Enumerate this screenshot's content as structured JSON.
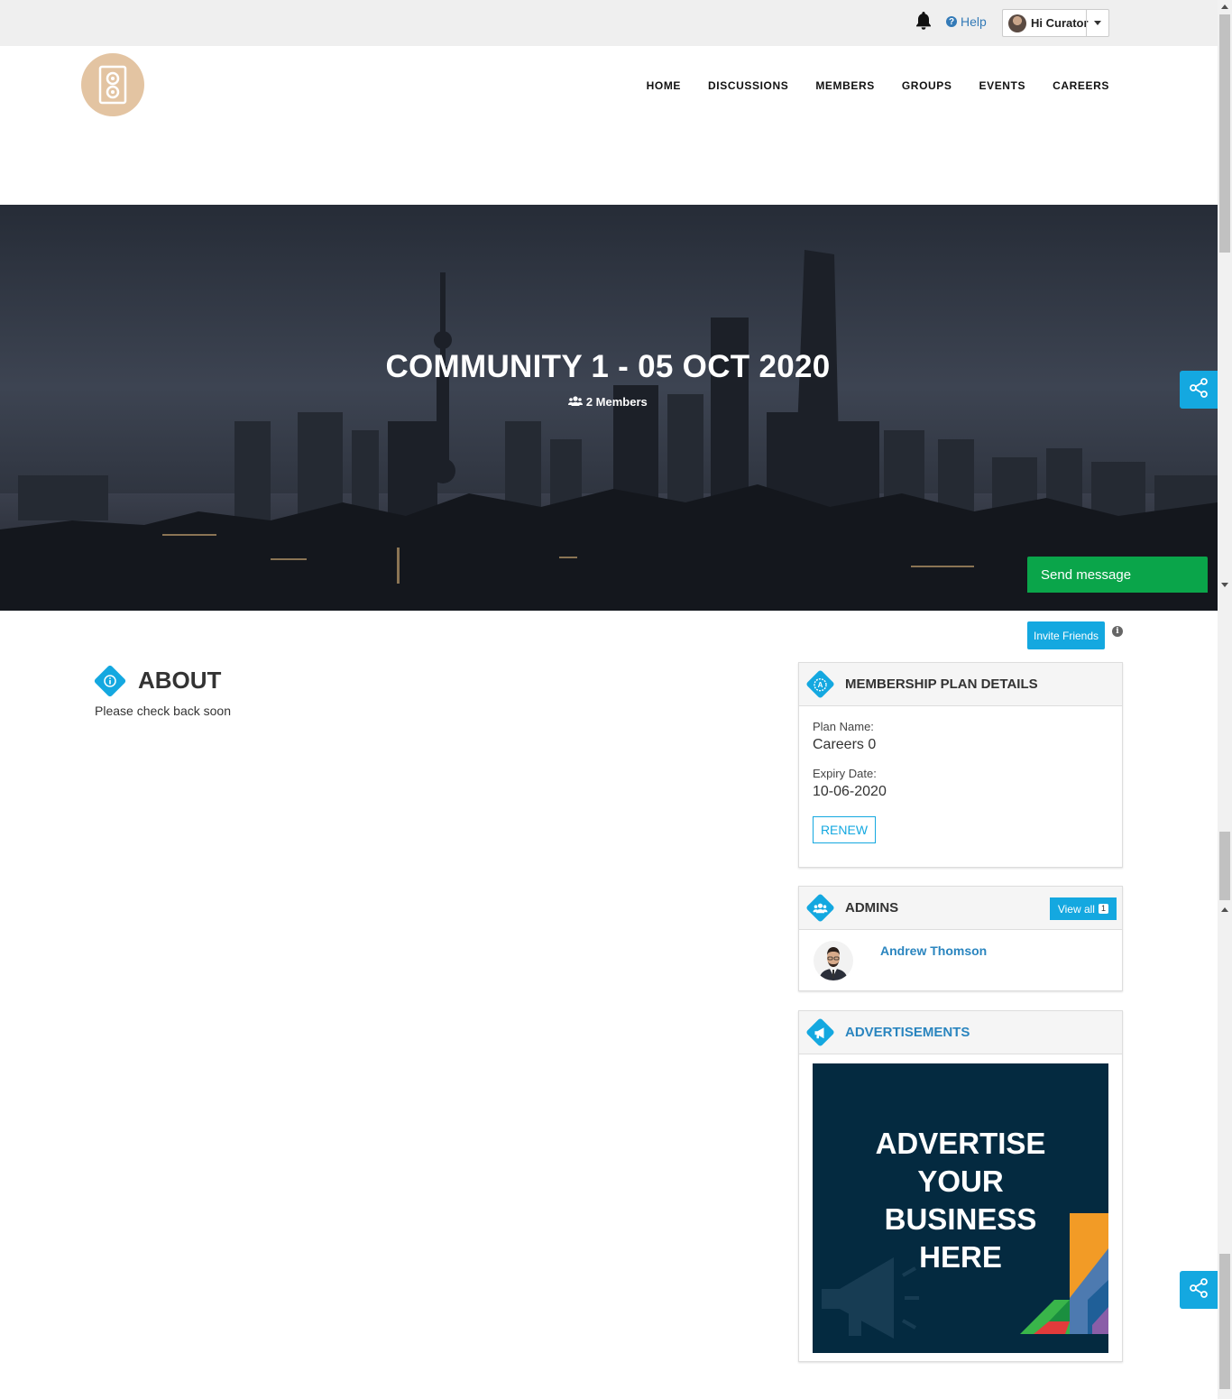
{
  "topbar": {
    "help_label": "Help",
    "user_label": "Hi Curator"
  },
  "nav": {
    "items": [
      "HOME",
      "DISCUSSIONS",
      "MEMBERS",
      "GROUPS",
      "EVENTS",
      "CAREERS"
    ]
  },
  "hero": {
    "title": "COMMUNITY 1 - 05 OCT 2020",
    "members": "2 Members",
    "send_message": "Send message"
  },
  "actions": {
    "invite_friends": "Invite Friends"
  },
  "about": {
    "title": "ABOUT",
    "text": "Please check back soon"
  },
  "membership": {
    "title": "MEMBERSHIP PLAN DETAILS",
    "plan_label": "Plan Name:",
    "plan_value": "Careers 0",
    "expiry_label": "Expiry Date:",
    "expiry_value": "10-06-2020",
    "renew_label": "RENEW"
  },
  "admins": {
    "title": "ADMINS",
    "view_all_label": "View all",
    "view_all_count": "1",
    "items": [
      {
        "name": "Andrew Thomson"
      }
    ]
  },
  "advertisements": {
    "title": "ADVERTISEMENTS",
    "ad_text": "ADVERTISE YOUR BUSINESS HERE"
  },
  "colors": {
    "accent": "#14a8e0",
    "send_message": "#0aa54a",
    "link": "#2a85bf",
    "logo": "#e3c4a2",
    "ad_background": "#042a40"
  },
  "icons": {
    "notifications": "bell-icon",
    "help": "question-circle-icon",
    "members": "users-icon",
    "share": "share-icon",
    "info": "info-icon",
    "about": "info-diamond-icon",
    "membership": "membership-badge-icon",
    "admins": "users-diamond-icon",
    "advertisements": "megaphone-diamond-icon"
  }
}
